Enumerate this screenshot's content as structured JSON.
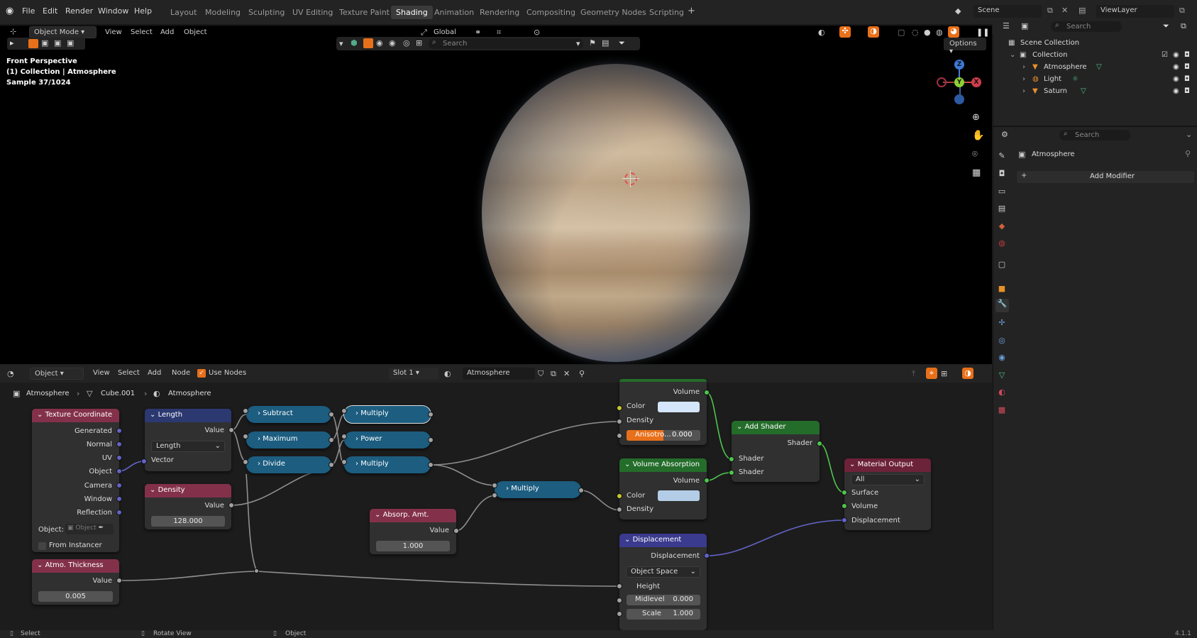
{
  "topbar": {
    "menus": [
      "File",
      "Edit",
      "Render",
      "Window",
      "Help"
    ],
    "workspaces": [
      "Layout",
      "Modeling",
      "Sculpting",
      "UV Editing",
      "Texture Paint",
      "Shading",
      "Animation",
      "Rendering",
      "Compositing",
      "Geometry Nodes",
      "Scripting"
    ],
    "active_workspace": "Shading",
    "add_tab": "+",
    "scene": "Scene",
    "view_layer": "ViewLayer"
  },
  "viewport": {
    "mode": "Object Mode",
    "menus": [
      "View",
      "Select",
      "Add",
      "Object"
    ],
    "orientation": "Global",
    "search_placeholder": "Search",
    "options": "Options",
    "overlay": [
      "Front Perspective",
      "(1) Collection | Atmosphere",
      "Sample 37/1024"
    ],
    "gizmo": {
      "z": "Z",
      "y": "Y",
      "x": "X"
    }
  },
  "outliner": {
    "search_placeholder": "Search",
    "root": "Scene Collection",
    "collection": "Collection",
    "items": [
      "Atmosphere",
      "Light",
      "Saturn"
    ]
  },
  "properties": {
    "search_placeholder": "Search",
    "object_name": "Atmosphere",
    "add_modifier": "Add Modifier"
  },
  "node_editor": {
    "object_type": "Object",
    "menus": [
      "View",
      "Select",
      "Add",
      "Node"
    ],
    "use_nodes": "Use Nodes",
    "slot": "Slot 1",
    "material": "Atmosphere",
    "breadcrumb": [
      "Atmosphere",
      "Cube.001",
      "Atmosphere"
    ],
    "nodes": {
      "texture_coordinate": {
        "title": "Texture Coordinate",
        "outputs": [
          "Generated",
          "Normal",
          "UV",
          "Object",
          "Camera",
          "Window",
          "Reflection"
        ],
        "object_label": "Object:",
        "object_placeholder": "Object",
        "from_instancer": "From Instancer"
      },
      "length": {
        "title": "Length",
        "output": "Value",
        "mode": "Length",
        "input": "Vector"
      },
      "density": {
        "title": "Density",
        "output": "Value",
        "value": "128.000"
      },
      "atmo_thickness": {
        "title": "Atmo. Thickness",
        "output": "Value",
        "value": "0.005"
      },
      "subtract": "Subtract",
      "maximum": "Maximum",
      "divide": "Divide",
      "multiply1": "Multiply",
      "power": "Power",
      "multiply2": "Multiply",
      "multiply3": "Multiply",
      "absorp": {
        "title": "Absorp. Amt.",
        "output": "Value",
        "value": "1.000"
      },
      "volume_scatter": {
        "output": "Volume",
        "color": "Color",
        "density": "Density",
        "anisotropy_label": "Anisotro...",
        "anisotropy": "0.000"
      },
      "volume_absorption": {
        "title": "Volume Absorption",
        "output": "Volume",
        "color": "Color",
        "density": "Density"
      },
      "add_shader": {
        "title": "Add Shader",
        "output": "Shader",
        "inputs": [
          "Shader",
          "Shader"
        ]
      },
      "displacement": {
        "title": "Displacement",
        "output": "Displacement",
        "space": "Object Space",
        "height": "Height",
        "midlevel_label": "Midlevel",
        "midlevel": "0.000",
        "scale_label": "Scale",
        "scale": "1.000"
      },
      "material_output": {
        "title": "Material Output",
        "target": "All",
        "inputs": [
          "Surface",
          "Volume",
          "Displacement"
        ]
      }
    }
  },
  "statusbar": {
    "select": "Select",
    "rotate": "Rotate View",
    "object": "Object",
    "version": "4.1.1"
  },
  "colors": {
    "accent": "#e8701a",
    "math_node": "#1c5d80",
    "input_header": "#83314a",
    "shader_header": "#246c2a",
    "scatter_color": "#d5e6fb",
    "absorption_color": "#b3cde6"
  }
}
